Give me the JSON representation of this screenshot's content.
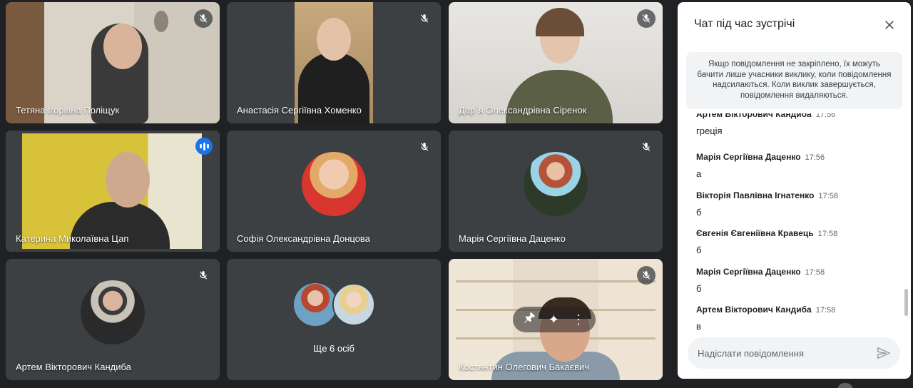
{
  "participants": [
    {
      "name": "Тетяна Ігорівна Поліщук"
    },
    {
      "name": "Анастасія Сергіївна Хоменко"
    },
    {
      "name": "Дар`я Олександрівна Сіренок"
    },
    {
      "name": "Катерина Миколаївна Цап"
    },
    {
      "name": "Софія Олександрівна Донцова"
    },
    {
      "name": "Марія Сергіївна Даценко"
    },
    {
      "name": "Артем Вікторович Кандиба"
    },
    {
      "name": "Ще 6 осіб"
    },
    {
      "name": "Костянтин Олегович Бакаєвич"
    }
  ],
  "chat": {
    "title": "Чат під час зустрічі",
    "notice": "Якщо повідомлення не закріплено, їх можуть бачити лише учасники виклику, коли повідомлення надсилаються. Коли виклик завершується, повідомлення видаляються.",
    "messages": [
      {
        "sender": "Артем Вікторович Кандиба",
        "time": "17:56",
        "text": "греція"
      },
      {
        "sender": "Марія Сергіївна Даценко",
        "time": "17:56",
        "text": "а"
      },
      {
        "sender": "Вікторія Павлівна Ігнатенко",
        "time": "17:58",
        "text": "б"
      },
      {
        "sender": "Євгенія Євгеніївна Кравець",
        "time": "17:58",
        "text": "б"
      },
      {
        "sender": "Марія Сергіївна Даценко",
        "time": "17:58",
        "text": "б"
      },
      {
        "sender": "Артем Вікторович Кандиба",
        "time": "17:58",
        "text": "в"
      }
    ],
    "input_placeholder": "Надіслати повідомлення"
  },
  "icons": {
    "mic_off": "mic-off-icon",
    "speaking": "audio-level-icon",
    "close": "close-icon",
    "send": "send-icon",
    "pin": "pin-icon",
    "effects": "sparkle-icon",
    "more": "more-vert-icon"
  },
  "colors": {
    "background": "#202124",
    "tile": "#3c4043",
    "speaking_outline": "#8ab4f8",
    "speaking_badge": "#1a73e8",
    "panel": "#ffffff"
  }
}
